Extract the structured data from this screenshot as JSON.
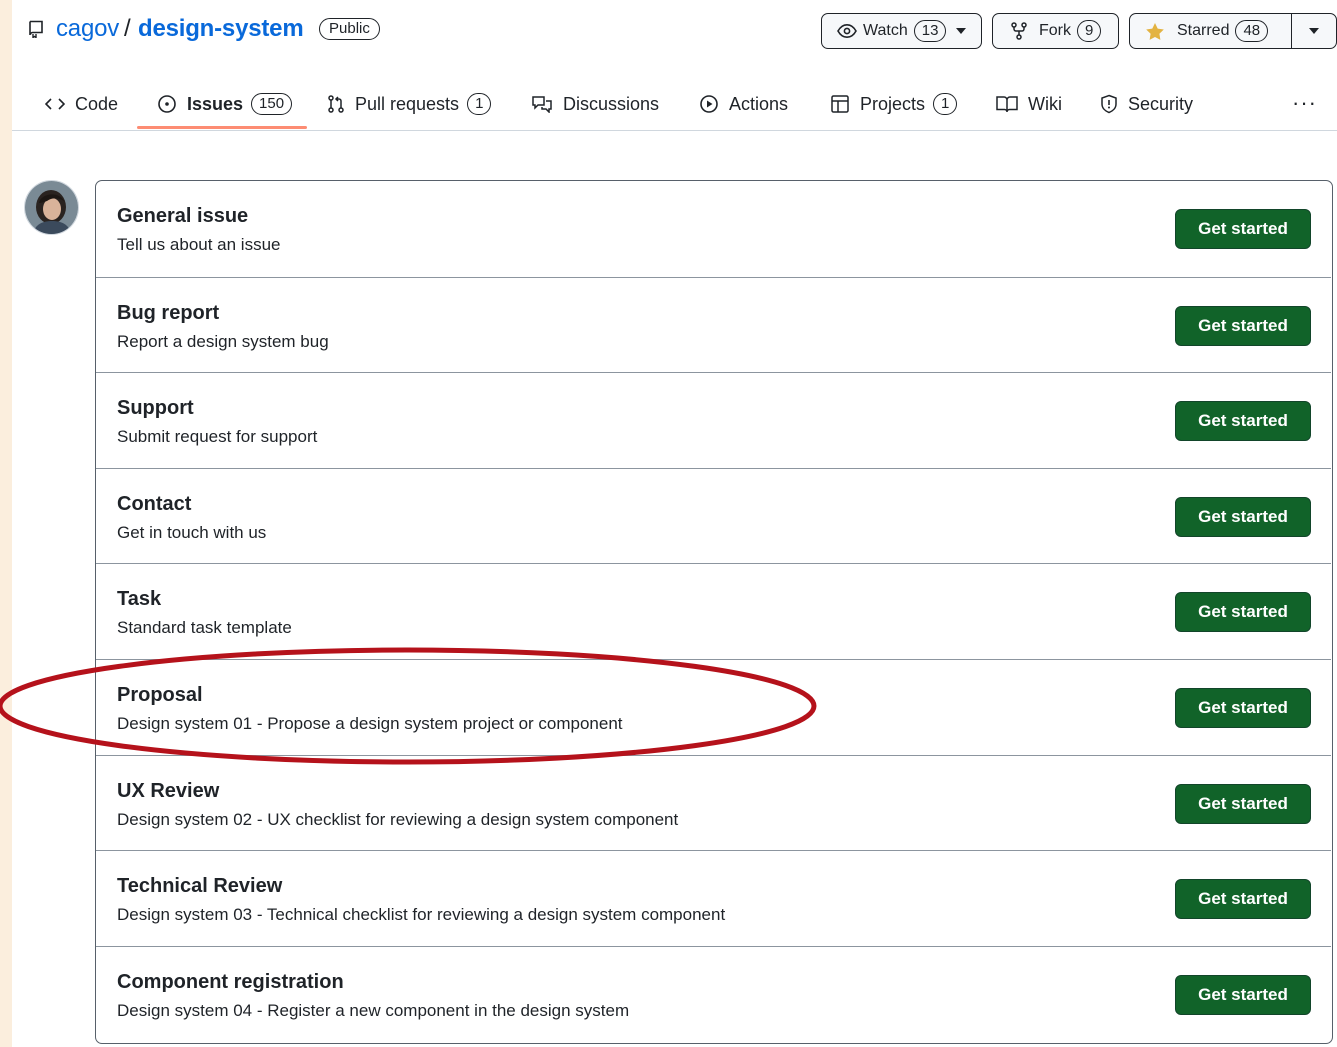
{
  "repo": {
    "owner": "cagov",
    "separator": "/",
    "name": "design-system",
    "visibility": "Public"
  },
  "actions": {
    "watch": {
      "label": "Watch",
      "count": "13"
    },
    "fork": {
      "label": "Fork",
      "count": "9"
    },
    "star": {
      "label": "Starred",
      "count": "48"
    }
  },
  "tabs": [
    {
      "label": "Code",
      "icon": "code-icon"
    },
    {
      "label": "Issues",
      "icon": "issue-icon",
      "count": "150",
      "active": true
    },
    {
      "label": "Pull requests",
      "icon": "pull-request-icon",
      "count": "1"
    },
    {
      "label": "Discussions",
      "icon": "discussions-icon"
    },
    {
      "label": "Actions",
      "icon": "play-icon"
    },
    {
      "label": "Projects",
      "icon": "table-icon",
      "count": "1"
    },
    {
      "label": "Wiki",
      "icon": "book-icon"
    },
    {
      "label": "Security",
      "icon": "shield-icon"
    }
  ],
  "more_label": "···",
  "templates": [
    {
      "title": "General issue",
      "description": "Tell us about an issue",
      "button": "Get started"
    },
    {
      "title": "Bug report",
      "description": "Report a design system bug",
      "button": "Get started"
    },
    {
      "title": "Support",
      "description": "Submit request for support",
      "button": "Get started"
    },
    {
      "title": "Contact",
      "description": "Get in touch with us",
      "button": "Get started"
    },
    {
      "title": "Task",
      "description": "Standard task template",
      "button": "Get started"
    },
    {
      "title": "Proposal",
      "description": "Design system 01 - Propose a design system project or component",
      "button": "Get started"
    },
    {
      "title": "UX Review",
      "description": "Design system 02 - UX checklist for reviewing a design system component",
      "button": "Get started"
    },
    {
      "title": "Technical Review",
      "description": "Design system 03 - Technical checklist for reviewing a design system component",
      "button": "Get started"
    },
    {
      "title": "Component registration",
      "description": "Design system 04 - Register a new component in the design system",
      "button": "Get started"
    }
  ],
  "colors": {
    "link": "#0969da",
    "primary_button": "#116329",
    "active_tab_underline": "#fd8c73",
    "star": "#e3b341",
    "highlight_ellipse": "#b5121b",
    "background": "#fbeedd"
  }
}
